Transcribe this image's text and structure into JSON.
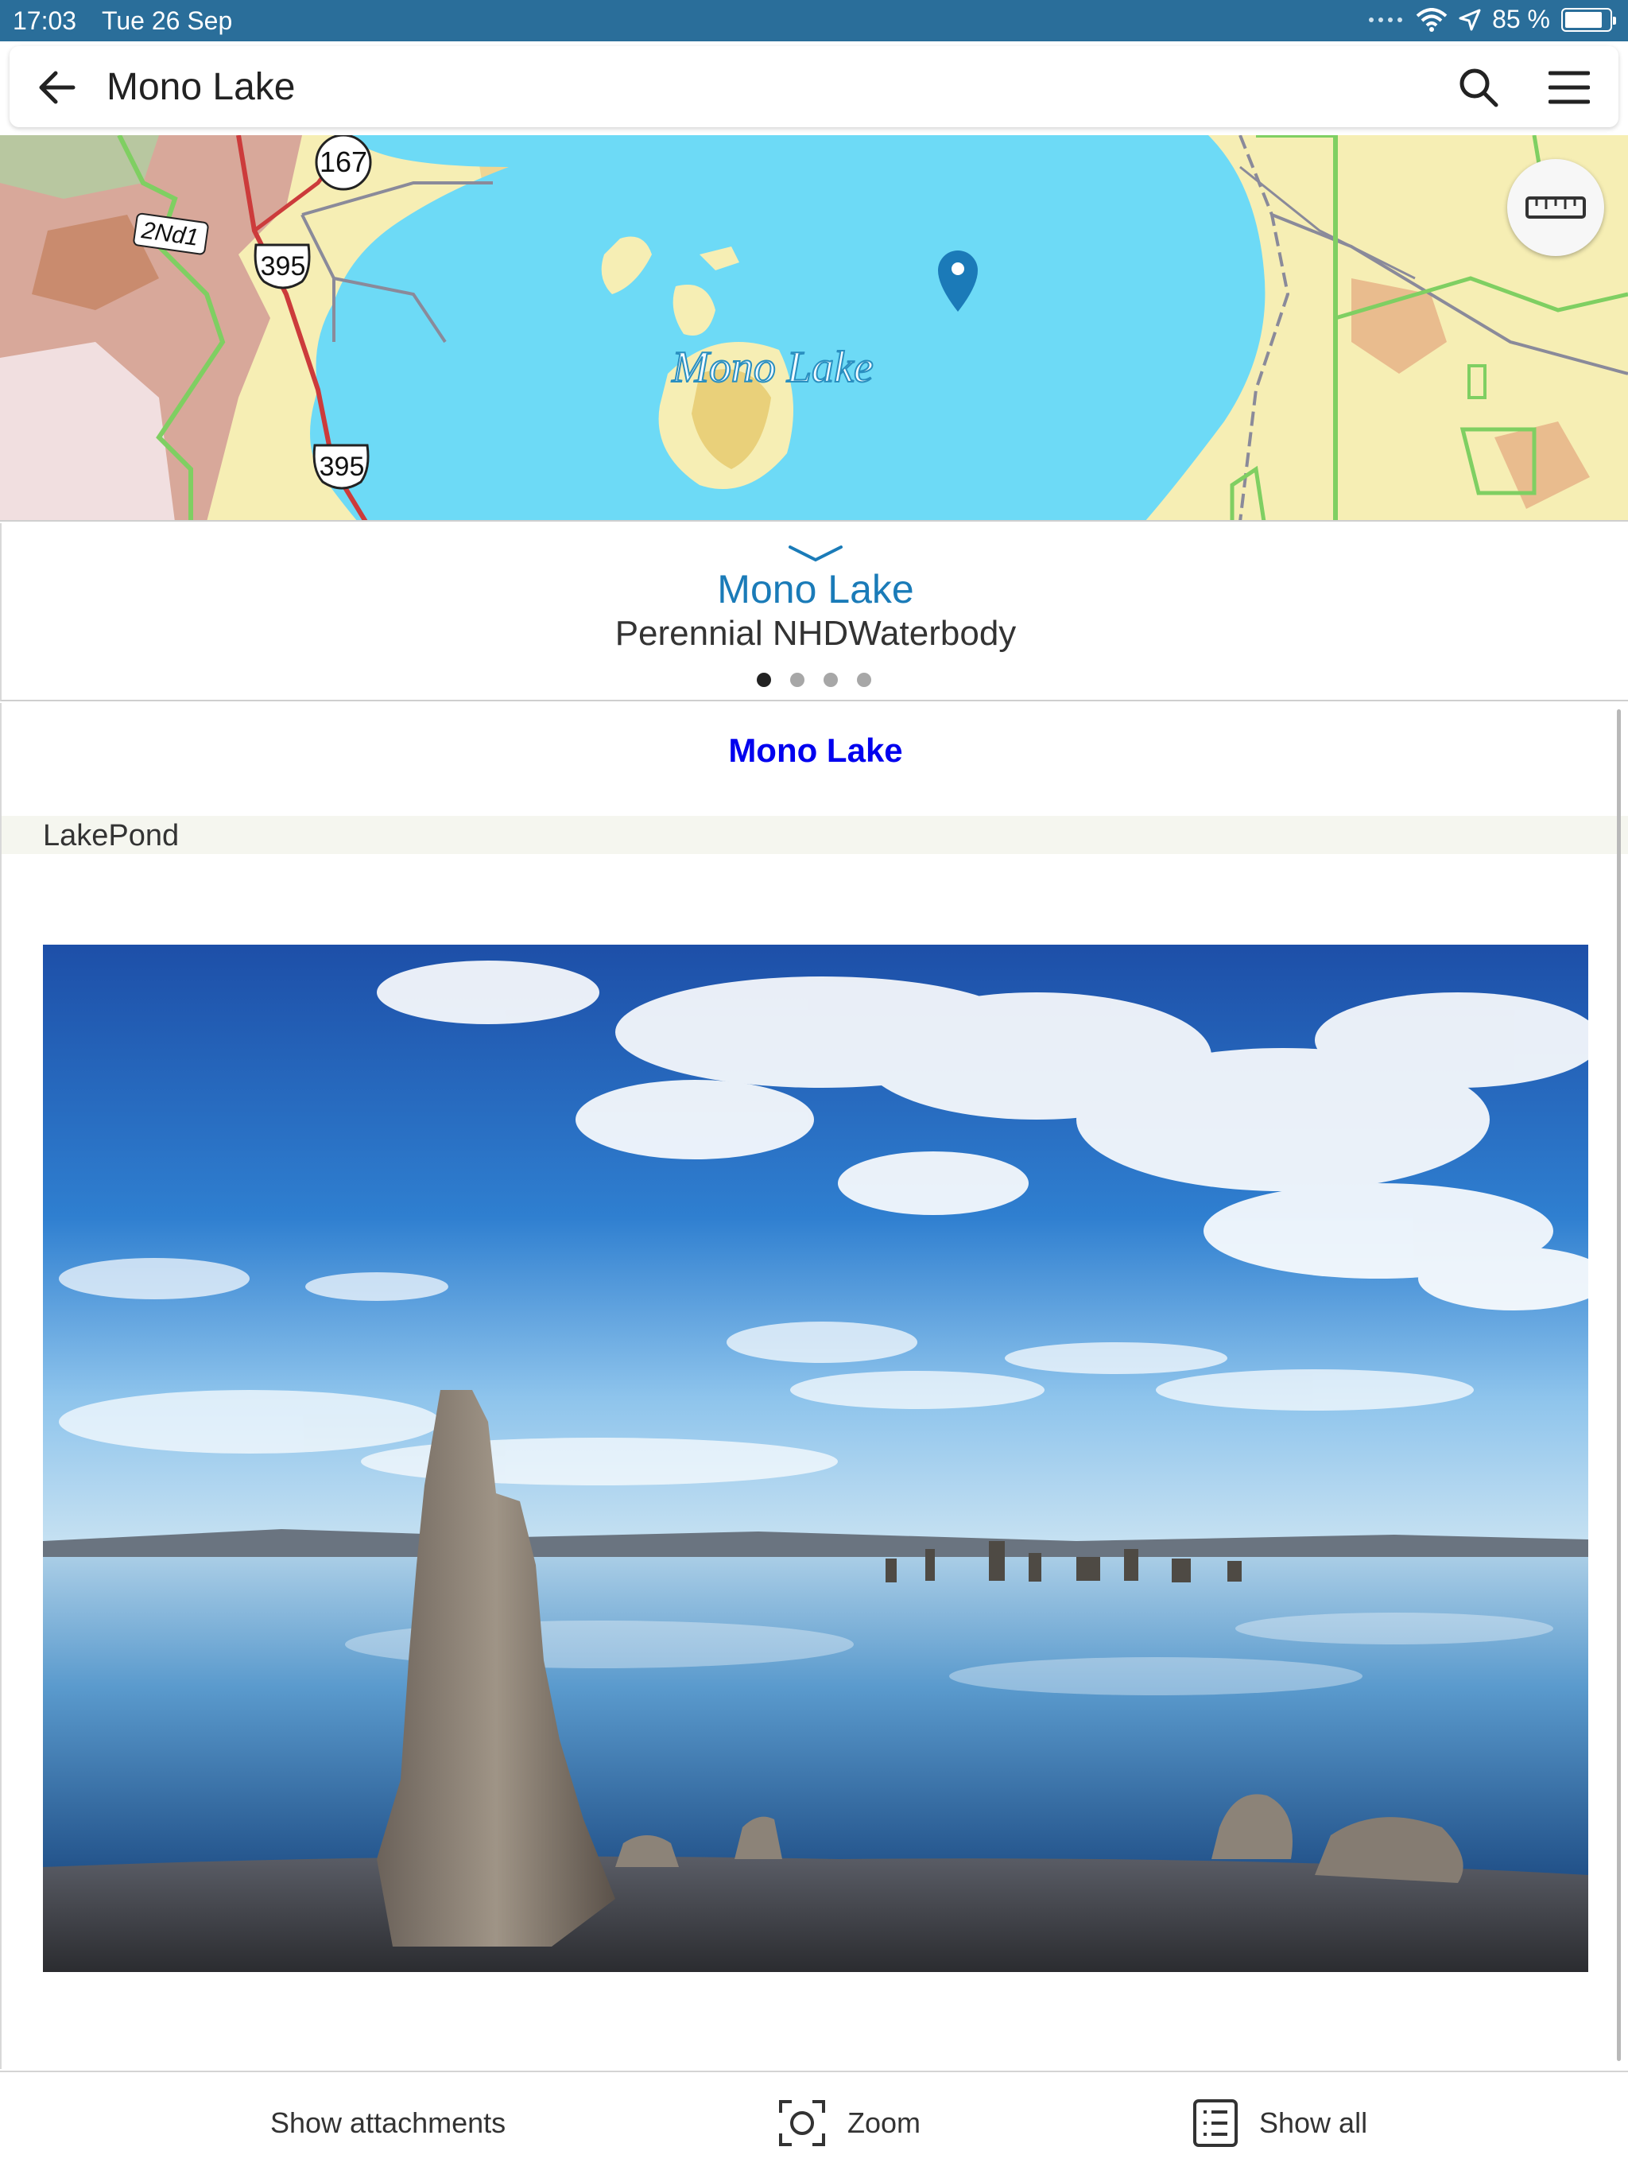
{
  "status_bar": {
    "time": "17:03",
    "date": "Tue 26 Sep",
    "battery": "85 %",
    "battery_level": 0.85
  },
  "header": {
    "title": "Mono Lake"
  },
  "map": {
    "labels": {
      "lake": "Mono Lake",
      "route_167": "167",
      "route_395_top": "395",
      "route_395_bottom": "395",
      "road_2nd1": "2Nd1"
    },
    "colors": {
      "water": "#6ddaf6",
      "land": "#f6eeb4",
      "pin": "#1b7ab8"
    }
  },
  "popup": {
    "title": "Mono Lake",
    "subtitle": "Perennial NHDWaterbody",
    "page_count": 4,
    "active_page": 1
  },
  "content": {
    "title": "Mono Lake",
    "field_value": "LakePond"
  },
  "toolbar": {
    "attachments_label": "Show attachments",
    "zoom_label": "Zoom",
    "show_all_label": "Show all"
  },
  "icons": {
    "back": "arrow-left-icon",
    "search": "search-icon",
    "menu": "hamburger-menu-icon",
    "measure": "ruler-icon",
    "zoom": "zoom-frame-icon",
    "show_all": "list-icon"
  }
}
